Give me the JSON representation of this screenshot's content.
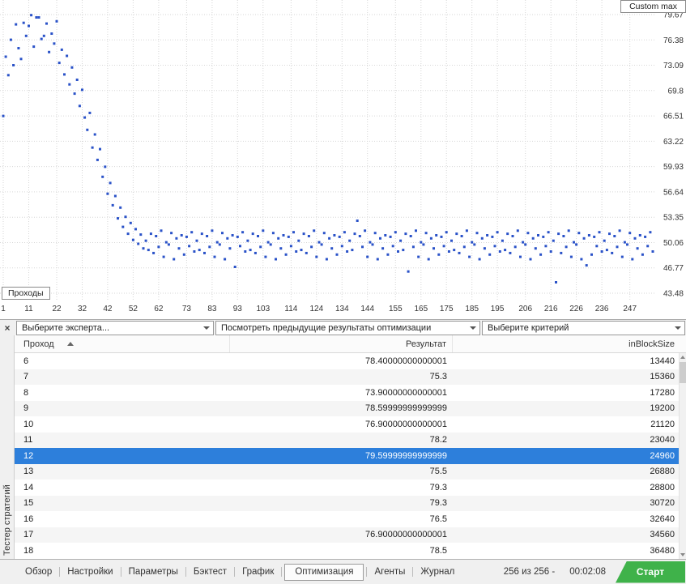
{
  "sidebar_label": "Тестер стратегий",
  "chart": {
    "corner_label": "Custom max",
    "x_axis_label": "Проходы",
    "dot_color": "#2a52c8",
    "y_ticks": [
      "79.67",
      "76.38",
      "73.09",
      "69.8",
      "66.51",
      "63.22",
      "59.93",
      "56.64",
      "53.35",
      "50.06",
      "46.77",
      "43.48"
    ],
    "x_ticks": [
      1,
      11,
      22,
      32,
      42,
      52,
      62,
      73,
      83,
      93,
      103,
      114,
      124,
      134,
      144,
      155,
      165,
      175,
      185,
      195,
      206,
      216,
      226,
      236,
      247
    ]
  },
  "chart_data": {
    "type": "scatter",
    "title": "Custom max",
    "xlabel": "Проходы",
    "ylabel": "",
    "xlim": [
      1,
      256
    ],
    "ylim": [
      43.48,
      79.67
    ],
    "x_start": 1,
    "y_values": [
      66.5,
      74.2,
      71.8,
      76.4,
      73.1,
      78.4,
      75.3,
      73.9,
      78.6,
      76.9,
      78.2,
      79.6,
      75.5,
      79.3,
      79.3,
      76.5,
      76.9,
      78.5,
      74.8,
      77.2,
      75.9,
      78.8,
      73.4,
      75.1,
      71.9,
      74.3,
      70.6,
      72.8,
      69.4,
      71.2,
      67.8,
      69.9,
      66.3,
      64.7,
      66.9,
      62.4,
      64.1,
      60.8,
      62.2,
      58.6,
      59.9,
      56.4,
      57.8,
      54.9,
      56.1,
      53.2,
      54.6,
      52.1,
      53.4,
      51.2,
      52.6,
      50.4,
      51.8,
      49.9,
      51.1,
      49.3,
      50.3,
      49.1,
      51.2,
      48.7,
      50.9,
      49.5,
      51.6,
      48.2,
      50.1,
      49.8,
      51.3,
      47.9,
      50.6,
      49.3,
      51.0,
      48.5,
      50.8,
      49.6,
      51.4,
      48.9,
      50.3,
      49.1,
      51.2,
      48.7,
      50.9,
      49.5,
      51.6,
      48.2,
      50.1,
      49.8,
      51.3,
      47.9,
      50.6,
      49.3,
      51.0,
      46.9,
      50.8,
      49.6,
      51.4,
      48.9,
      50.3,
      49.1,
      51.2,
      48.7,
      50.9,
      49.5,
      51.6,
      48.2,
      50.1,
      49.8,
      51.3,
      47.9,
      50.6,
      49.3,
      51.0,
      48.5,
      50.8,
      49.6,
      51.4,
      48.9,
      50.3,
      49.1,
      51.2,
      48.7,
      50.9,
      49.5,
      51.6,
      48.2,
      50.1,
      49.8,
      51.3,
      47.9,
      50.6,
      49.3,
      51.0,
      48.5,
      50.8,
      49.6,
      51.4,
      48.9,
      50.3,
      49.1,
      51.2,
      52.9,
      50.9,
      49.5,
      51.6,
      48.2,
      50.1,
      49.8,
      51.3,
      47.9,
      50.6,
      49.3,
      51.0,
      48.5,
      50.8,
      49.6,
      51.4,
      48.9,
      50.3,
      49.1,
      51.2,
      46.3,
      50.9,
      49.5,
      51.6,
      48.2,
      50.1,
      49.8,
      51.3,
      47.9,
      50.6,
      49.3,
      51.0,
      48.5,
      50.8,
      49.6,
      51.4,
      48.9,
      50.3,
      49.1,
      51.2,
      48.7,
      50.9,
      49.5,
      51.6,
      48.2,
      50.1,
      49.8,
      51.3,
      47.9,
      50.6,
      49.3,
      51.0,
      48.5,
      50.8,
      49.6,
      51.4,
      48.9,
      50.3,
      49.1,
      51.2,
      48.7,
      50.9,
      49.5,
      51.6,
      48.2,
      50.1,
      49.8,
      51.3,
      47.9,
      50.6,
      49.3,
      51.0,
      48.5,
      50.8,
      49.6,
      51.4,
      48.9,
      50.3,
      44.9,
      51.2,
      48.7,
      50.9,
      49.5,
      51.6,
      48.2,
      50.1,
      49.8,
      51.3,
      47.9,
      50.6,
      47.1,
      51.0,
      48.5,
      50.8,
      49.6,
      51.4,
      48.9,
      50.3,
      49.1,
      51.2,
      48.7,
      50.9,
      49.5,
      51.6,
      48.2,
      50.1,
      49.8,
      51.3,
      47.9,
      50.6,
      49.3,
      51.0,
      48.5,
      50.8,
      49.6,
      51.4,
      48.9
    ]
  },
  "toolbar": {
    "close_glyph": "×",
    "expert_combo": "Выберите эксперта...",
    "results_combo": "Посмотреть предыдущие результаты оптимизации",
    "criterion_combo": "Выберите критерий"
  },
  "table": {
    "header": {
      "pass": "Проход",
      "result": "Результат",
      "block": "inBlockSize"
    },
    "selected_pass": "12",
    "rows": [
      {
        "pass": "6",
        "result": "78.40000000000001",
        "block": "13440"
      },
      {
        "pass": "7",
        "result": "75.3",
        "block": "15360"
      },
      {
        "pass": "8",
        "result": "73.90000000000001",
        "block": "17280"
      },
      {
        "pass": "9",
        "result": "78.59999999999999",
        "block": "19200"
      },
      {
        "pass": "10",
        "result": "76.90000000000001",
        "block": "21120"
      },
      {
        "pass": "11",
        "result": "78.2",
        "block": "23040"
      },
      {
        "pass": "12",
        "result": "79.59999999999999",
        "block": "24960"
      },
      {
        "pass": "13",
        "result": "75.5",
        "block": "26880"
      },
      {
        "pass": "14",
        "result": "79.3",
        "block": "28800"
      },
      {
        "pass": "15",
        "result": "79.3",
        "block": "30720"
      },
      {
        "pass": "16",
        "result": "76.5",
        "block": "32640"
      },
      {
        "pass": "17",
        "result": "76.90000000000001",
        "block": "34560"
      },
      {
        "pass": "18",
        "result": "78.5",
        "block": "36480"
      }
    ]
  },
  "tabs": [
    "Обзор",
    "Настройки",
    "Параметры",
    "Бэктест",
    "График",
    "Оптимизация",
    "Агенты",
    "Журнал"
  ],
  "active_tab": "Оптимизация",
  "status": {
    "progress": "256 из 256 -",
    "time": "00:02:08",
    "start_label": "Старт"
  }
}
